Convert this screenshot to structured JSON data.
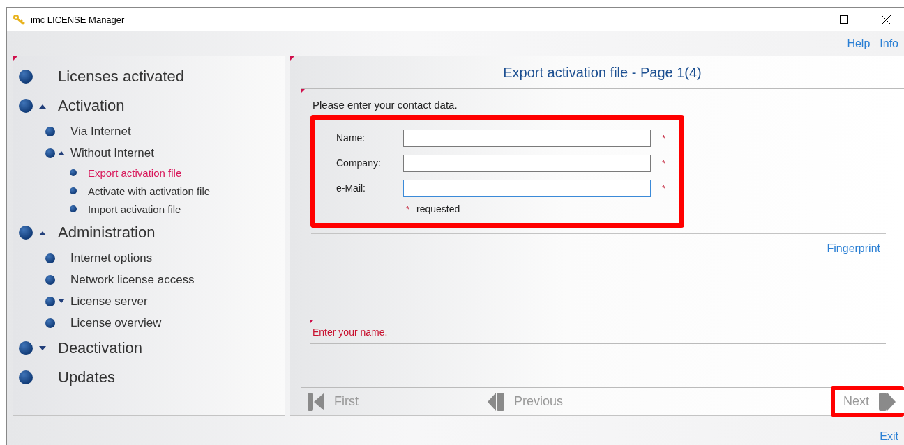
{
  "window": {
    "title": "imc LICENSE Manager"
  },
  "top_links": [
    "Help",
    "Info"
  ],
  "tree": [
    {
      "label": "Licenses activated",
      "selected": false
    },
    {
      "label": "Activation",
      "selected": false,
      "expanded": true,
      "children": [
        {
          "label": "Via Internet",
          "selected": false
        },
        {
          "label": "Without Internet",
          "selected": false,
          "expanded": true,
          "children": [
            {
              "label": "Export activation file",
              "selected": true
            },
            {
              "label": "Activate with activation file",
              "selected": false
            },
            {
              "label": "Import activation file",
              "selected": false
            }
          ]
        }
      ]
    },
    {
      "label": "Administration",
      "selected": false,
      "expanded": true,
      "children": [
        {
          "label": "Internet options",
          "selected": false
        },
        {
          "label": "Network license access",
          "selected": false
        },
        {
          "label": "License server",
          "selected": false,
          "expanded": false
        },
        {
          "label": "License overview",
          "selected": false
        }
      ]
    },
    {
      "label": "Deactivation",
      "selected": false,
      "expanded": false
    },
    {
      "label": "Updates",
      "selected": false
    }
  ],
  "page_title": "Export activation file - Page 1(4)",
  "form": {
    "intro": "Please enter your contact data.",
    "annotation_frame": true,
    "fields": [
      {
        "label": "Name:",
        "required_mark": "*",
        "focused": false
      },
      {
        "label": "Company:",
        "required_mark": "*",
        "focused": false
      },
      {
        "label": "e-Mail:",
        "required_mark": "*",
        "focused": true
      }
    ],
    "legend_mark": "*",
    "legend": "requested"
  },
  "fingerprint_link": "Fingerprint",
  "message": "Enter your name.",
  "nav": [
    {
      "kind": "first",
      "label": "First",
      "disabled": true,
      "annotation_frame": false
    },
    {
      "kind": "previous",
      "label": "Previous",
      "disabled": true,
      "annotation_frame": false
    },
    {
      "kind": "next",
      "label": "Next",
      "disabled": true,
      "annotation_frame": true
    }
  ],
  "exit_link": "Exit"
}
